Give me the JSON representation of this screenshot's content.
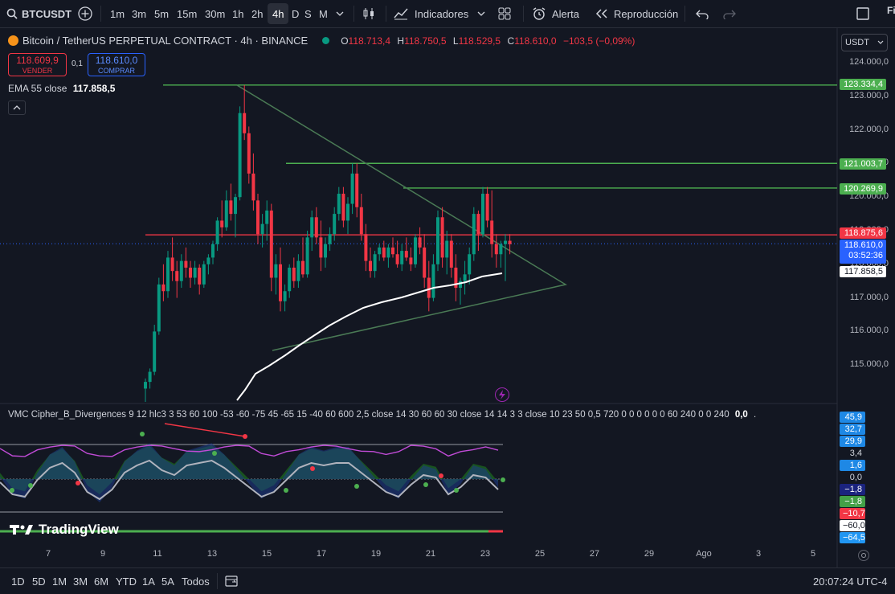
{
  "toolbar": {
    "symbol": "BTCUSDT",
    "timeframes": [
      "1m",
      "3m",
      "5m",
      "15m",
      "30m",
      "1h",
      "2h",
      "4h",
      "D",
      "S",
      "M"
    ],
    "active_timeframe": "4h",
    "indicators_label": "Indicadores",
    "alert_label": "Alerta",
    "replay_label": "Reproducción",
    "right_fragment": "Fi"
  },
  "legend": {
    "title": "Bitcoin / TetherUS PERPETUAL CONTRACT · 4h · BINANCE",
    "open": "118.713,4",
    "high": "118.750,5",
    "low": "118.529,5",
    "close": "118.610,0",
    "change": "−103,5 (−0,09%)",
    "o_label": "O",
    "h_label": "H",
    "l_label": "L",
    "c_label": "C",
    "sell_price": "118.609,9",
    "sell_label": "VENDER",
    "spread": "0,1",
    "buy_price": "118.610,0",
    "buy_label": "COMPRAR",
    "ema_label": "EMA 55 close",
    "ema_value": "117.858,5"
  },
  "currency_button": "USDT",
  "price_axis": [
    "124.000,0",
    "123.000,0",
    "122.000,0",
    "121.000,0",
    "120.000,0",
    "119.000,0",
    "118.000,0",
    "117.000,0",
    "116.000,0",
    "115.000,0"
  ],
  "price_tags": {
    "level1": "123.334,4",
    "level2": "121.003,7",
    "level3": "120.269,9",
    "red_level": "118.875,6",
    "last_price": "118.610,0",
    "countdown": "03:52:36",
    "ema": "117.858,5"
  },
  "indicator": {
    "legend": "VMC Cipher_B_Divergences 9 12 hlc3 3 53 60 100 -53 -60 -75 45 -65 15 -40 60 600 2,5 close 14 30 60 60 30 close 14 14 3 3 close 10 23 50 0,5 720 0 0 0 0 0 0 60 240 0 0 240",
    "value": "0,0",
    "axis_tags": [
      "45,9",
      "32,7",
      "29,9",
      "3,4",
      "1,6",
      "0,0",
      "−1,8",
      "−1,8",
      "−10,7",
      "−60,0",
      "−64,5"
    ]
  },
  "date_axis": [
    "7",
    "9",
    "11",
    "13",
    "15",
    "17",
    "19",
    "21",
    "23",
    "25",
    "27",
    "29",
    "Ago",
    "3",
    "5"
  ],
  "bottom": {
    "ranges": [
      "1D",
      "5D",
      "1M",
      "3M",
      "6M",
      "YTD",
      "1A",
      "5A",
      "Todos"
    ],
    "clock": "20:07:24 UTC-4"
  },
  "brand": "TradingView",
  "colors": {
    "up": "#089981",
    "down": "#f23645",
    "level_green": "#4caf50",
    "red_line": "#f23645",
    "ema": "#ffffff",
    "accent": "#2962ff"
  },
  "chart_data": {
    "type": "candlestick",
    "interval": "4h",
    "ylim": [
      114800,
      124400
    ],
    "x_ticks": [
      "7",
      "9",
      "11",
      "13",
      "15",
      "17",
      "19",
      "21",
      "23",
      "25",
      "27",
      "29",
      "Ago",
      "3",
      "5"
    ],
    "horizontal_levels": [
      123334.4,
      121003.7,
      120269.9,
      118875.6
    ],
    "ema55_last": 117858.5,
    "last_close": 118610.0,
    "candles": [
      [
        114300,
        114600,
        113800,
        114500
      ],
      [
        114500,
        114900,
        114300,
        114800
      ],
      [
        114800,
        116200,
        114700,
        116000
      ],
      [
        116000,
        117600,
        115900,
        117400
      ],
      [
        117400,
        118000,
        116900,
        117200
      ],
      [
        117200,
        118400,
        117000,
        118200
      ],
      [
        118200,
        118800,
        117500,
        117800
      ],
      [
        117800,
        118100,
        117000,
        117500
      ],
      [
        117500,
        118300,
        117300,
        118100
      ],
      [
        118100,
        118500,
        117600,
        117900
      ],
      [
        117900,
        118100,
        117300,
        117600
      ],
      [
        117600,
        118100,
        117400,
        117900
      ],
      [
        117900,
        118000,
        117100,
        117400
      ],
      [
        117400,
        118100,
        117300,
        118000
      ],
      [
        118000,
        118300,
        117700,
        118200
      ],
      [
        118200,
        118700,
        118000,
        118600
      ],
      [
        118600,
        119400,
        118400,
        119300
      ],
      [
        119300,
        119900,
        118800,
        119100
      ],
      [
        119100,
        120200,
        119000,
        119900
      ],
      [
        119900,
        120400,
        119300,
        119500
      ],
      [
        119500,
        120100,
        118800,
        120000
      ],
      [
        120000,
        122700,
        119900,
        122500
      ],
      [
        122500,
        123334,
        121700,
        121900
      ],
      [
        121900,
        122100,
        120400,
        120700
      ],
      [
        120700,
        121300,
        119600,
        119900
      ],
      [
        119900,
        120100,
        118600,
        118900
      ],
      [
        118900,
        119500,
        118500,
        119200
      ],
      [
        119200,
        119900,
        118700,
        119600
      ],
      [
        119600,
        119800,
        117200,
        117600
      ],
      [
        117600,
        118300,
        117100,
        118000
      ],
      [
        118000,
        118500,
        116600,
        116900
      ],
      [
        116900,
        117400,
        116600,
        117200
      ],
      [
        117200,
        118000,
        117000,
        117900
      ],
      [
        117900,
        118200,
        117300,
        117500
      ],
      [
        117500,
        118300,
        117300,
        118100
      ],
      [
        118100,
        118800,
        117600,
        117700
      ],
      [
        117700,
        119000,
        117600,
        118800
      ],
      [
        118800,
        119600,
        118400,
        119400
      ],
      [
        119400,
        119700,
        118600,
        118800
      ],
      [
        118800,
        119300,
        117800,
        118200
      ],
      [
        118200,
        118800,
        117900,
        118600
      ],
      [
        118600,
        119100,
        118400,
        118900
      ],
      [
        118900,
        119700,
        118700,
        119500
      ],
      [
        119500,
        120300,
        119300,
        120100
      ],
      [
        120100,
        120300,
        119100,
        119300
      ],
      [
        119300,
        120000,
        118900,
        119800
      ],
      [
        119800,
        121000,
        119500,
        120700
      ],
      [
        120700,
        121000,
        119400,
        119700
      ],
      [
        119700,
        120100,
        118700,
        118900
      ],
      [
        118900,
        119200,
        117800,
        118100
      ],
      [
        118100,
        118500,
        117600,
        117800
      ],
      [
        117800,
        118400,
        117600,
        118300
      ],
      [
        118300,
        118600,
        118100,
        118500
      ],
      [
        118500,
        118700,
        118100,
        118200
      ],
      [
        118200,
        118600,
        117900,
        118500
      ],
      [
        118500,
        118800,
        118200,
        118300
      ],
      [
        118300,
        118700,
        117900,
        118000
      ],
      [
        118000,
        118600,
        117800,
        118400
      ],
      [
        118400,
        118800,
        118100,
        118200
      ],
      [
        118200,
        118500,
        117800,
        118000
      ],
      [
        118000,
        118900,
        117900,
        118800
      ],
      [
        118800,
        119100,
        118300,
        118500
      ],
      [
        118500,
        118900,
        117300,
        117600
      ],
      [
        117600,
        118100,
        116600,
        117000
      ],
      [
        117000,
        118300,
        116900,
        118000
      ],
      [
        118000,
        119600,
        117800,
        119400
      ],
      [
        119400,
        119700,
        117900,
        118200
      ],
      [
        118200,
        119000,
        117700,
        118700
      ],
      [
        118700,
        118900,
        117600,
        117900
      ],
      [
        117900,
        118300,
        116900,
        117300
      ],
      [
        117300,
        117600,
        116800,
        117500
      ],
      [
        117500,
        118100,
        117100,
        117700
      ],
      [
        117700,
        118500,
        117400,
        118300
      ],
      [
        118300,
        119700,
        118100,
        119500
      ],
      [
        119500,
        119600,
        118400,
        118900
      ],
      [
        118900,
        120300,
        118800,
        120100
      ],
      [
        120100,
        120300,
        119100,
        119300
      ],
      [
        119300,
        120200,
        118200,
        118600
      ],
      [
        118600,
        118900,
        117900,
        118300
      ],
      [
        118300,
        118700,
        117900,
        118600
      ],
      [
        118600,
        118900,
        117500,
        118700
      ],
      [
        118700,
        118900,
        118300,
        118600
      ]
    ]
  }
}
